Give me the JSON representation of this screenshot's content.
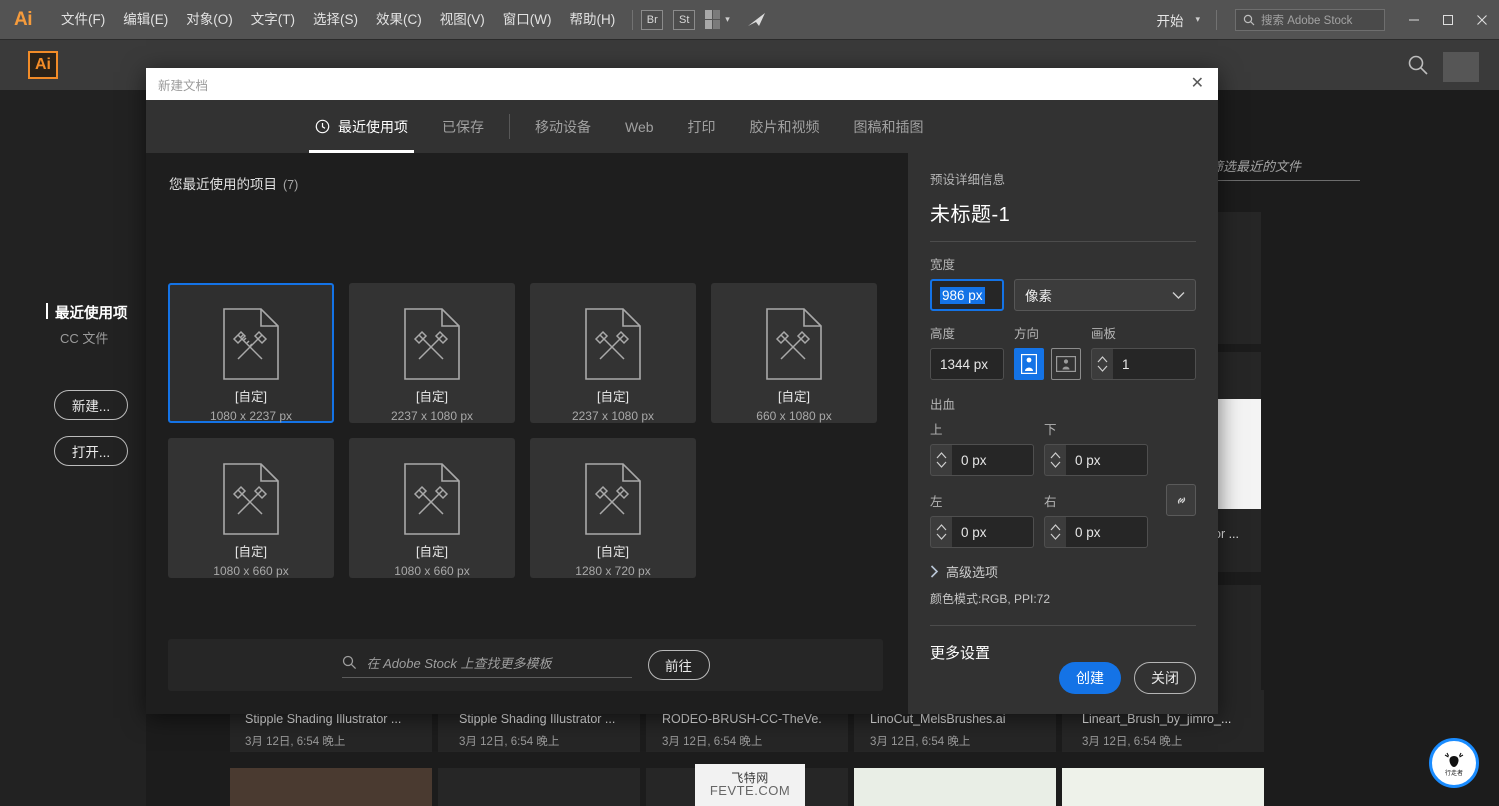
{
  "app": {
    "logo": "Ai",
    "menus": [
      {
        "label": "文件(F)"
      },
      {
        "label": "编辑(E)"
      },
      {
        "label": "对象(O)"
      },
      {
        "label": "文字(T)"
      },
      {
        "label": "选择(S)"
      },
      {
        "label": "效果(C)"
      },
      {
        "label": "视图(V)"
      },
      {
        "label": "窗口(W)"
      },
      {
        "label": "帮助(H)"
      }
    ],
    "bridge_label": "Br",
    "stock_label": "St",
    "start_label": "开始",
    "stock_search_placeholder": "搜索 Adobe Stock",
    "window_buttons": {
      "minimize": "—",
      "maximize": "▢",
      "close": "✕"
    }
  },
  "home": {
    "badge": "Ai",
    "sidebar": {
      "active_item": "最近使用项",
      "secondary_item": "CC 文件",
      "new_button": "新建...",
      "open_button": "打开..."
    },
    "filter_placeholder": "筛选最近的文件",
    "files": [
      {
        "name": "Stipple Shading Illustrator ...",
        "date": "3月 12日, 6:54 晚上"
      },
      {
        "name": "Stipple Shading Illustrator ...",
        "date": "3月 12日, 6:54 晚上"
      },
      {
        "name": "RODEO-BRUSH-CC-TheVe...",
        "date": "3月 12日, 6:54 晚上"
      },
      {
        "name": "LinoCut_MelsBrushes.ai",
        "date": "3月 12日, 6:54 晚上"
      },
      {
        "name": "Lineart_Brush_by_jimro_...",
        "date": "3月 12日, 6:54 晚上"
      }
    ],
    "partial_file_label": "or ...",
    "watermark": {
      "line1": "飞特网",
      "line2": "FEVTE.COM"
    },
    "badge_logo_text": "行走者"
  },
  "dialog": {
    "title": "新建文档",
    "close_icon": "✕",
    "tabs": [
      {
        "label": "最近使用项",
        "active": true,
        "icon": "clock-icon"
      },
      {
        "label": "已保存",
        "active": false
      },
      {
        "label": "移动设备",
        "active": false
      },
      {
        "label": "Web",
        "active": false
      },
      {
        "label": "打印",
        "active": false
      },
      {
        "label": "胶片和视频",
        "active": false
      },
      {
        "label": "图稿和插图",
        "active": false
      }
    ],
    "section": {
      "title": "您最近使用的项目",
      "count": "(7)"
    },
    "presets": [
      {
        "name": "[自定]",
        "dims": "1080 x 2237 px",
        "selected": true
      },
      {
        "name": "[自定]",
        "dims": "2237 x 1080 px",
        "selected": false
      },
      {
        "name": "[自定]",
        "dims": "2237 x 1080 px",
        "selected": false
      },
      {
        "name": "[自定]",
        "dims": "660 x 1080 px",
        "selected": false
      },
      {
        "name": "[自定]",
        "dims": "1080 x 660 px",
        "selected": false
      },
      {
        "name": "[自定]",
        "dims": "1080 x 660 px",
        "selected": false
      },
      {
        "name": "[自定]",
        "dims": "1280 x 720 px",
        "selected": false
      }
    ],
    "stock_search": {
      "placeholder": "在 Adobe Stock 上查找更多模板",
      "go_button": "前往"
    },
    "details": {
      "heading": "预设详细信息",
      "doc_name": "未标题-1",
      "width_label": "宽度",
      "width_value": "986 px",
      "unit_value": "像素",
      "height_label": "高度",
      "height_value": "1344 px",
      "orientation_label": "方向",
      "orientation_portrait": "portrait-icon",
      "orientation_landscape": "landscape-icon",
      "artboards_label": "画板",
      "artboards_value": "1",
      "bleed_label": "出血",
      "bleed_top_label": "上",
      "bleed_top_value": "0 px",
      "bleed_bottom_label": "下",
      "bleed_bottom_value": "0 px",
      "bleed_left_label": "左",
      "bleed_left_value": "0 px",
      "bleed_right_label": "右",
      "bleed_right_value": "0 px",
      "advanced_label": "高级选项",
      "color_mode": "颜色模式:RGB, PPI:72",
      "more_settings": "更多设置"
    },
    "actions": {
      "create": "创建",
      "close": "关闭"
    }
  },
  "colors": {
    "accent": "#1473e6",
    "menubar_bg": "#535353",
    "dialog_bg": "#1e1e1e",
    "panel_bg": "#323232",
    "ai_orange": "#f28c28"
  }
}
